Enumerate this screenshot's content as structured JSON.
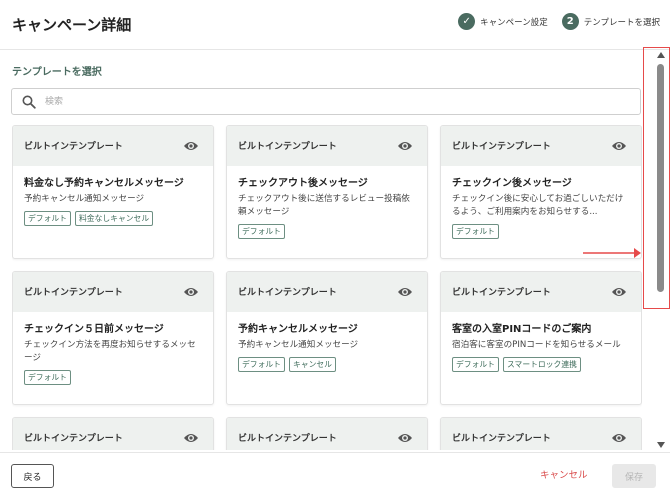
{
  "header": {
    "title": "キャンペーン詳細",
    "steps": [
      {
        "marker": "✓",
        "label": "キャンペーン設定"
      },
      {
        "marker": "2",
        "label": "テンプレートを選択"
      }
    ]
  },
  "section_title": "テンプレートを選択",
  "search": {
    "placeholder": "検索",
    "value": ""
  },
  "cards": [
    {
      "type": "ビルトインテンプレート",
      "title": "料金なし予約キャンセルメッセージ",
      "desc": "予約キャンセル通知メッセージ",
      "tags": [
        "デフォルト",
        "料金なしキャンセル"
      ]
    },
    {
      "type": "ビルトインテンプレート",
      "title": "チェックアウト後メッセージ",
      "desc": "チェックアウト後に送信するレビュー投稿依頼メッセージ",
      "tags": [
        "デフォルト"
      ]
    },
    {
      "type": "ビルトインテンプレート",
      "title": "チェックイン後メッセージ",
      "desc": "チェックイン後に安心してお過ごしいただけるよう、ご利用案内をお知らせする...",
      "tags": [
        "デフォルト"
      ]
    },
    {
      "type": "ビルトインテンプレート",
      "title": "チェックイン５日前メッセージ",
      "desc": "チェックイン方法を再度お知らせするメッセージ",
      "tags": [
        "デフォルト"
      ]
    },
    {
      "type": "ビルトインテンプレート",
      "title": "予約キャンセルメッセージ",
      "desc": "予約キャンセル通知メッセージ",
      "tags": [
        "デフォルト",
        "キャンセル"
      ]
    },
    {
      "type": "ビルトインテンプレート",
      "title": "客室の入室PINコードのご案内",
      "desc": "宿泊客に客室のPINコードを知らせるメール",
      "tags": [
        "デフォルト",
        "スマートロック連携"
      ]
    },
    {
      "type": "ビルトインテンプレート",
      "title": "",
      "desc": "",
      "tags": []
    },
    {
      "type": "ビルトインテンプレート",
      "title": "",
      "desc": "",
      "tags": []
    },
    {
      "type": "ビルトインテンプレート",
      "title": "",
      "desc": "",
      "tags": []
    }
  ],
  "footer": {
    "back_label": "戻る",
    "cancel_label": "キャンセル",
    "save_label": "保存"
  },
  "colors": {
    "accent": "#4a6b60",
    "card_header_bg": "#eef1ef",
    "cancel_text": "#d94a4a",
    "highlight": "#e64a4a"
  },
  "icons": {
    "step_done": "check-circle-icon",
    "preview": "eye-icon",
    "search": "search-icon"
  }
}
